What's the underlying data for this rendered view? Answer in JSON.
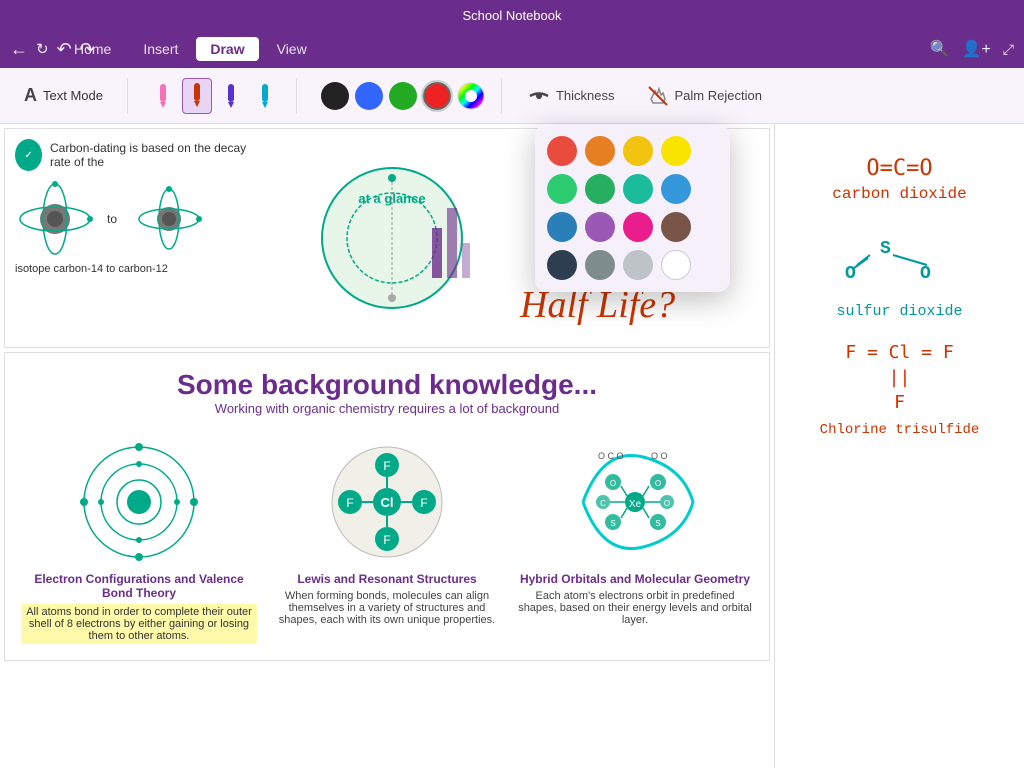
{
  "titleBar": {
    "title": "School Notebook"
  },
  "ribbonTabs": {
    "tabs": [
      {
        "id": "home",
        "label": "Home"
      },
      {
        "id": "insert",
        "label": "Insert"
      },
      {
        "id": "draw",
        "label": "Draw",
        "active": true
      },
      {
        "id": "view",
        "label": "View"
      }
    ],
    "navLeft": [
      "back",
      "sync",
      "undo",
      "redo"
    ],
    "navRight": [
      "search",
      "add-user",
      "minimize"
    ]
  },
  "toolbar": {
    "textMode": "Text Mode",
    "penColors": [
      "#f472b6",
      "#cc3300",
      "#5533cc",
      "#00aacc"
    ],
    "colorDots": [
      {
        "color": "#222222",
        "active": false
      },
      {
        "color": "#3366ff",
        "active": false
      },
      {
        "color": "#22aa22",
        "active": false
      },
      {
        "color": "#ee2222",
        "active": true
      }
    ],
    "thickness": "Thickness",
    "palmRejection": "Palm Rejection"
  },
  "colorPicker": {
    "colors": [
      "#e74c3c",
      "#e67e22",
      "#f1c40f",
      "#f9e400",
      "#2ecc71",
      "#27ae60",
      "#1abc9c",
      "#3498db",
      "#2980b9",
      "#9b59b6",
      "#e91e8c",
      "#795548",
      "#2c3e50",
      "#7f8c8d",
      "#bdc3c7",
      "#ffffff"
    ]
  },
  "noteContent": {
    "topSection": {
      "carbonDatingText": "Carbon-dating is based on the decay rate of the",
      "isotopeText": "isotope carbon-14 to carbon-12",
      "centerTitle": "at a glance",
      "halfLifeLabel": "Half Life?"
    },
    "backgroundSection": {
      "title": "Some background knowledge...",
      "subtitle": "Working with organic chemistry requires a lot of background",
      "cards": [
        {
          "title": "Electron Configurations and Valence Bond Theory",
          "desc": "All atoms bond in order to complete their outer shell of 8 electrons by either gaining or losing them to other atoms."
        },
        {
          "title": "Lewis and Resonant Structures",
          "desc": "When forming bonds, molecules can align themselves in a variety of structures and shapes, each with its own unique properties."
        },
        {
          "title": "Hybrid Orbitals and Molecular Geometry",
          "desc": "Each atom's electrons orbit in predefined shapes, based on their energy levels and orbital layer."
        }
      ]
    }
  },
  "rightPanel": {
    "formula1": "O=C=O",
    "name1": "carbon dioxide",
    "formula2": "O  S  O",
    "name2": "sulfur dioxide",
    "formula3": "F = Cl = F",
    "formula3b": "   ||",
    "formula3c": "   F",
    "name3": "Chlorine trisulfide"
  }
}
